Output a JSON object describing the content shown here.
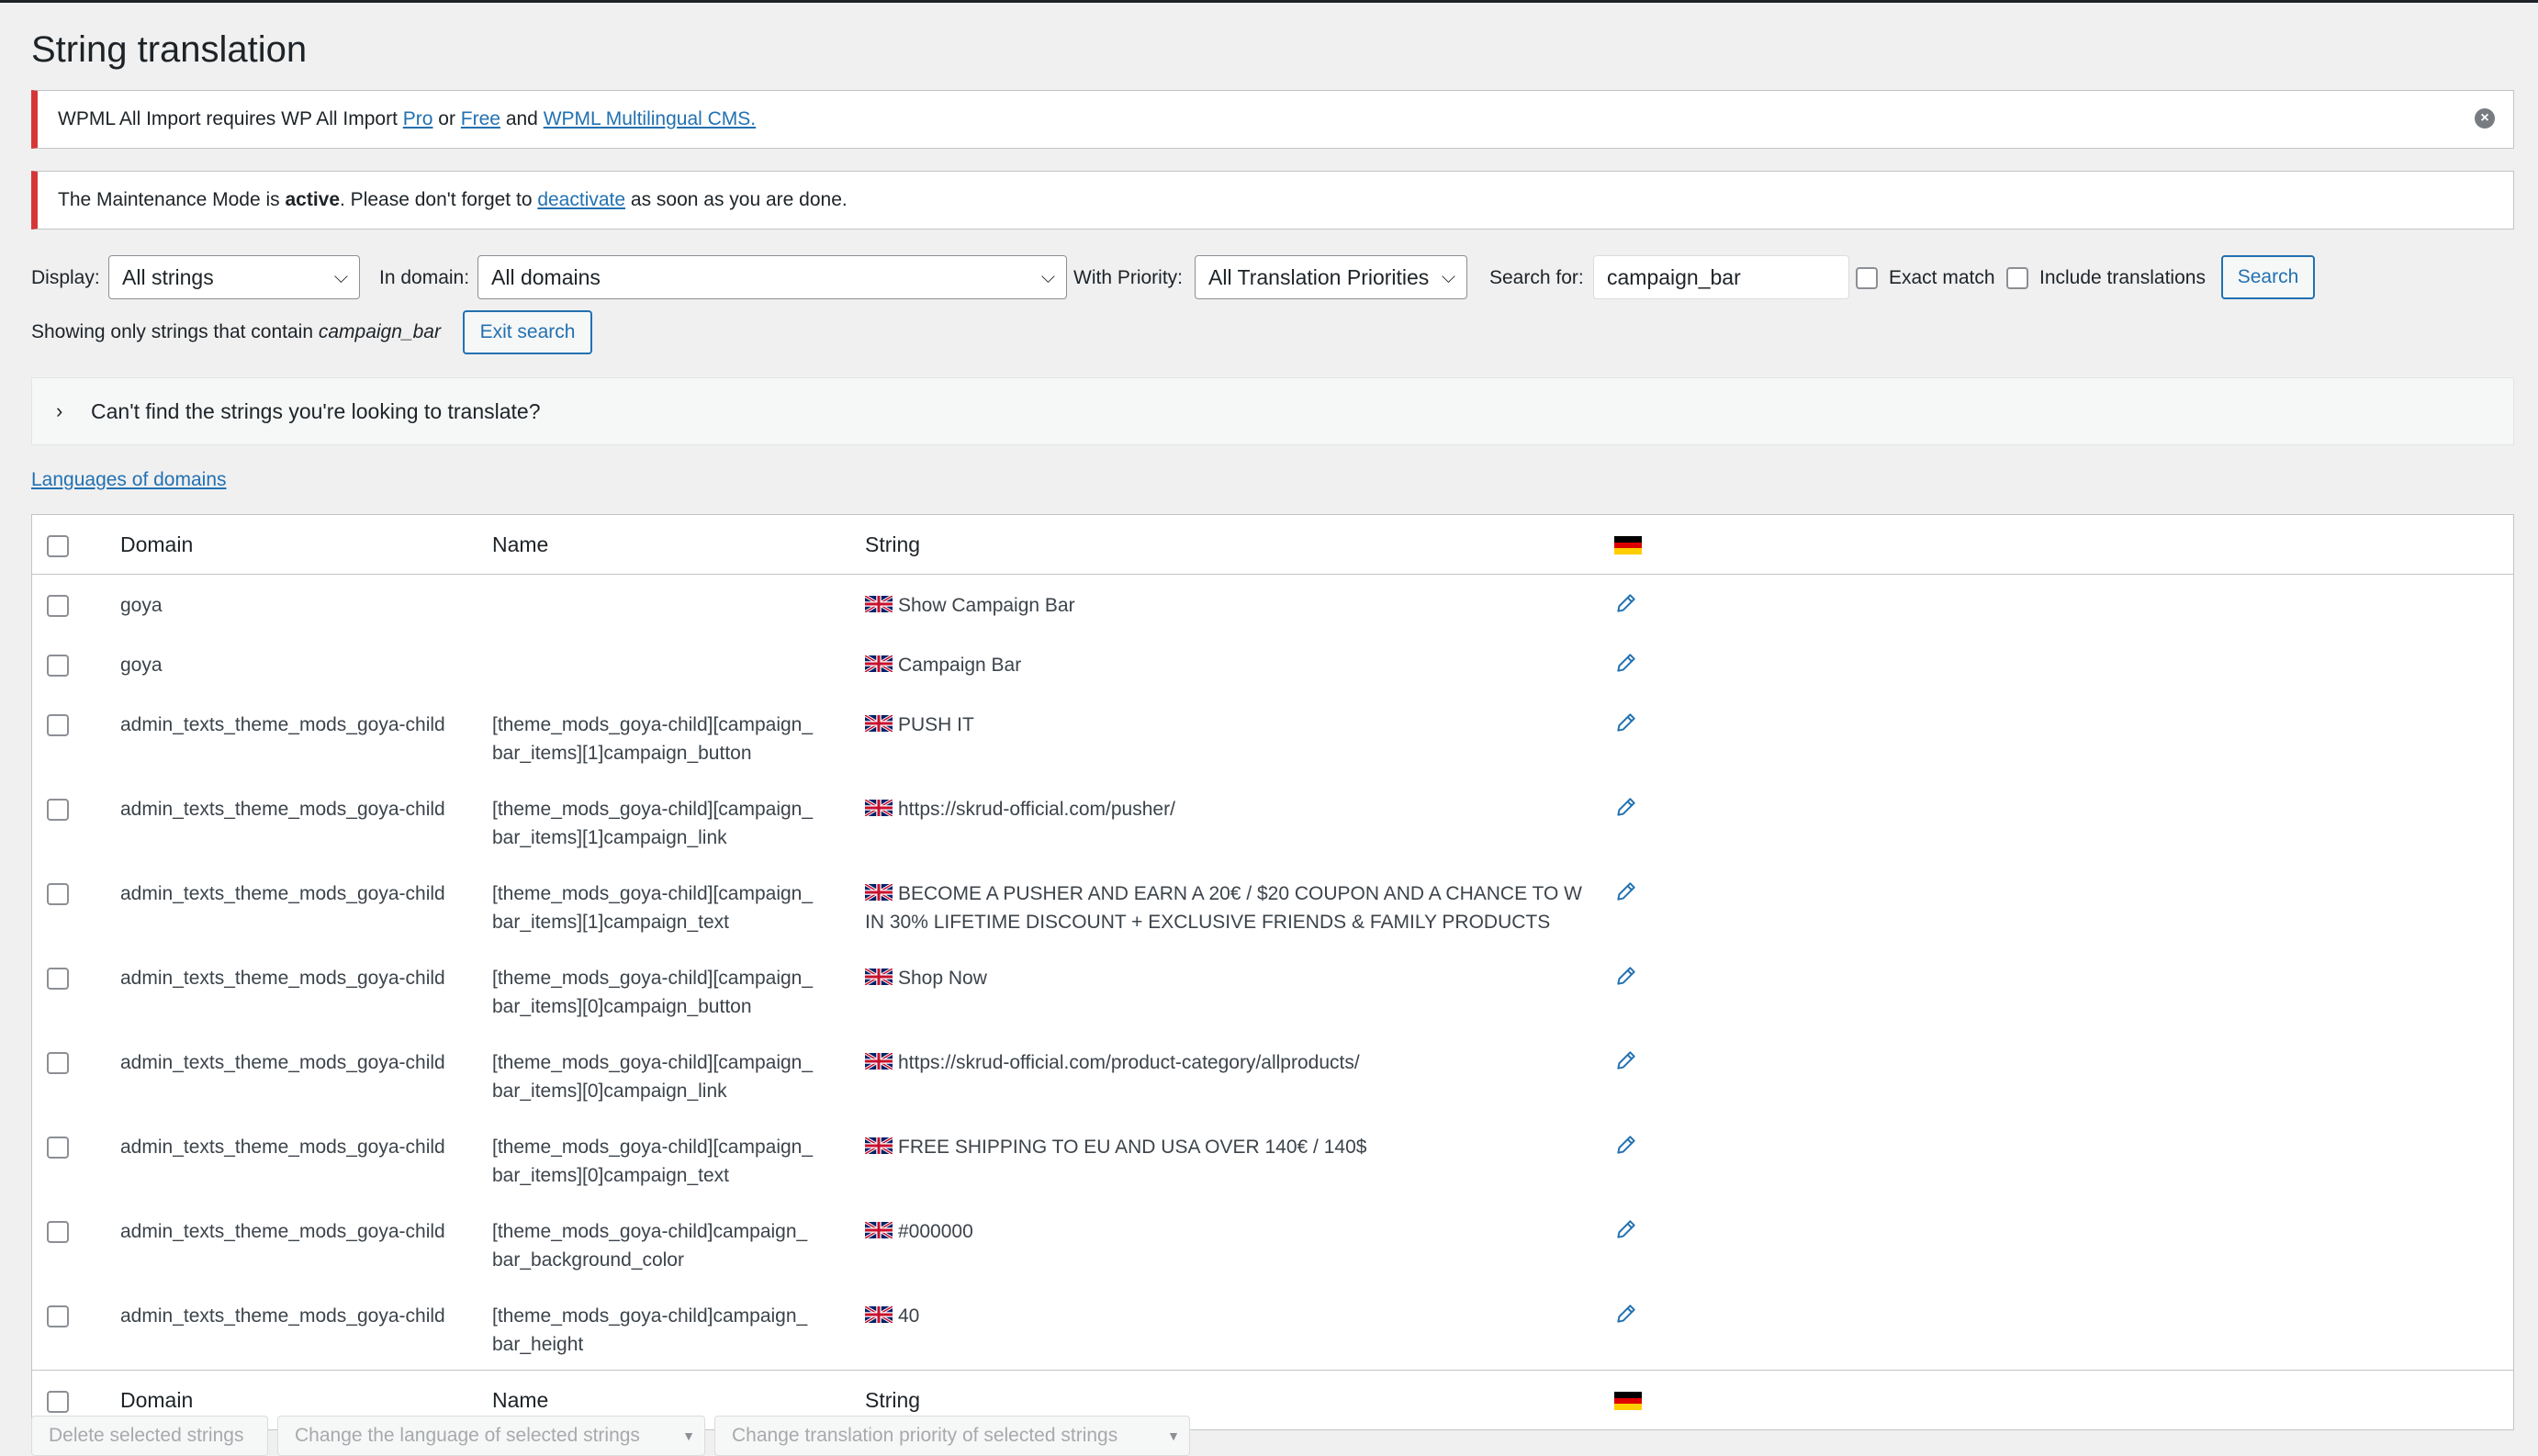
{
  "page": {
    "title": "String translation"
  },
  "notices": {
    "import": {
      "prefix": "WPML All Import requires WP All Import ",
      "link_pro": "Pro",
      "or": " or ",
      "link_free": "Free",
      "and": " and ",
      "link_wpml": "WPML Multilingual CMS.",
      "dismiss_icon": "close-circle-icon"
    },
    "maintenance": {
      "prefix": "The Maintenance Mode is ",
      "bold": "active",
      "middle": ". Please don't forget to ",
      "link": "deactivate",
      "suffix": " as soon as you are done."
    }
  },
  "filters": {
    "display_label": "Display:",
    "display_value": "All strings",
    "domain_label": "In domain:",
    "domain_value": "All domains",
    "priority_label": "With Priority:",
    "priority_value": "All Translation Priorities",
    "search_label": "Search for:",
    "search_value": "campaign_bar",
    "exact_match_label": "Exact match",
    "include_translations_label": "Include translations",
    "search_button": "Search"
  },
  "search_status": {
    "prefix": "Showing only strings that contain ",
    "term": "campaign_bar",
    "exit_button": "Exit search"
  },
  "help_panel": {
    "text": "Can't find the strings you're looking to translate?"
  },
  "languages_link": "Languages of domains",
  "table": {
    "headers": {
      "domain": "Domain",
      "name": "Name",
      "string": "String"
    },
    "rows": [
      {
        "domain": "goya",
        "name_1": "",
        "name_2": "",
        "string_1": "Show Campaign Bar",
        "string_2": ""
      },
      {
        "domain": "goya",
        "name_1": "",
        "name_2": "",
        "string_1": "Campaign Bar",
        "string_2": ""
      },
      {
        "domain": "admin_texts_theme_mods_goya-child",
        "name_1": "[theme_mods_goya-child][campaign_",
        "name_2": "bar_items][1]campaign_button",
        "string_1": "PUSH IT",
        "string_2": ""
      },
      {
        "domain": "admin_texts_theme_mods_goya-child",
        "name_1": "[theme_mods_goya-child][campaign_",
        "name_2": "bar_items][1]campaign_link",
        "string_1": "https://skrud-official.com/pusher/",
        "string_2": ""
      },
      {
        "domain": "admin_texts_theme_mods_goya-child",
        "name_1": "[theme_mods_goya-child][campaign_",
        "name_2": "bar_items][1]campaign_text",
        "string_1": "BECOME A PUSHER AND EARN A 20€ / $20 COUPON AND A CHANCE TO W",
        "string_2": "IN 30% LIFETIME DISCOUNT + EXCLUSIVE FRIENDS & FAMILY PRODUCTS"
      },
      {
        "domain": "admin_texts_theme_mods_goya-child",
        "name_1": "[theme_mods_goya-child][campaign_",
        "name_2": "bar_items][0]campaign_button",
        "string_1": "Shop Now",
        "string_2": ""
      },
      {
        "domain": "admin_texts_theme_mods_goya-child",
        "name_1": "[theme_mods_goya-child][campaign_",
        "name_2": "bar_items][0]campaign_link",
        "string_1": "https://skrud-official.com/product-category/allproducts/",
        "string_2": ""
      },
      {
        "domain": "admin_texts_theme_mods_goya-child",
        "name_1": "[theme_mods_goya-child][campaign_",
        "name_2": "bar_items][0]campaign_text",
        "string_1": "FREE SHIPPING TO EU AND USA OVER 140€ / 140$",
        "string_2": ""
      },
      {
        "domain": "admin_texts_theme_mods_goya-child",
        "name_1": "[theme_mods_goya-child]campaign_",
        "name_2": "bar_background_color",
        "string_1": "#000000",
        "string_2": ""
      },
      {
        "domain": "admin_texts_theme_mods_goya-child",
        "name_1": "[theme_mods_goya-child]campaign_",
        "name_2": "bar_height",
        "string_1": "40",
        "string_2": ""
      }
    ]
  },
  "bulk_actions": {
    "delete": "Delete selected strings",
    "change_language": "Change the language of selected strings",
    "change_priority": "Change translation priority of selected strings"
  },
  "colors": {
    "link": "#2271b1",
    "error": "#d63638"
  },
  "icons": {
    "source_flag": "uk-flag-icon",
    "target_flag": "germany-flag-icon",
    "edit": "pencil-icon"
  }
}
